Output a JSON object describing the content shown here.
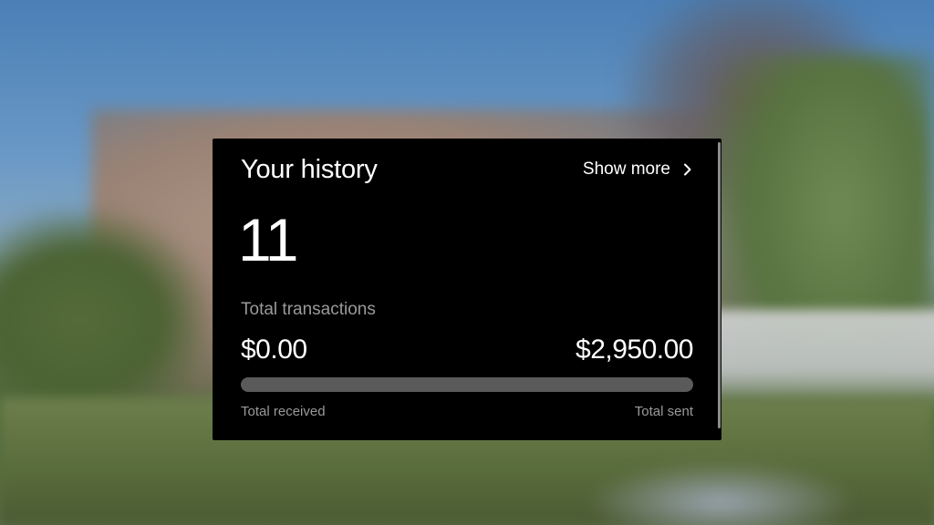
{
  "history": {
    "title": "Your history",
    "show_more_label": "Show more",
    "show_more_icon": "chevron-right-icon",
    "transaction_count": "11",
    "transaction_count_label": "Total transactions",
    "total_received": "$0.00",
    "total_sent": "$2,950.00",
    "total_received_label": "Total received",
    "total_sent_label": "Total sent",
    "received_fraction": 0.0
  },
  "colors": {
    "card_background": "#000000",
    "primary_text": "#ffffff",
    "secondary_text": "#9a9a9a",
    "bar_track": "#5a5a5a"
  }
}
